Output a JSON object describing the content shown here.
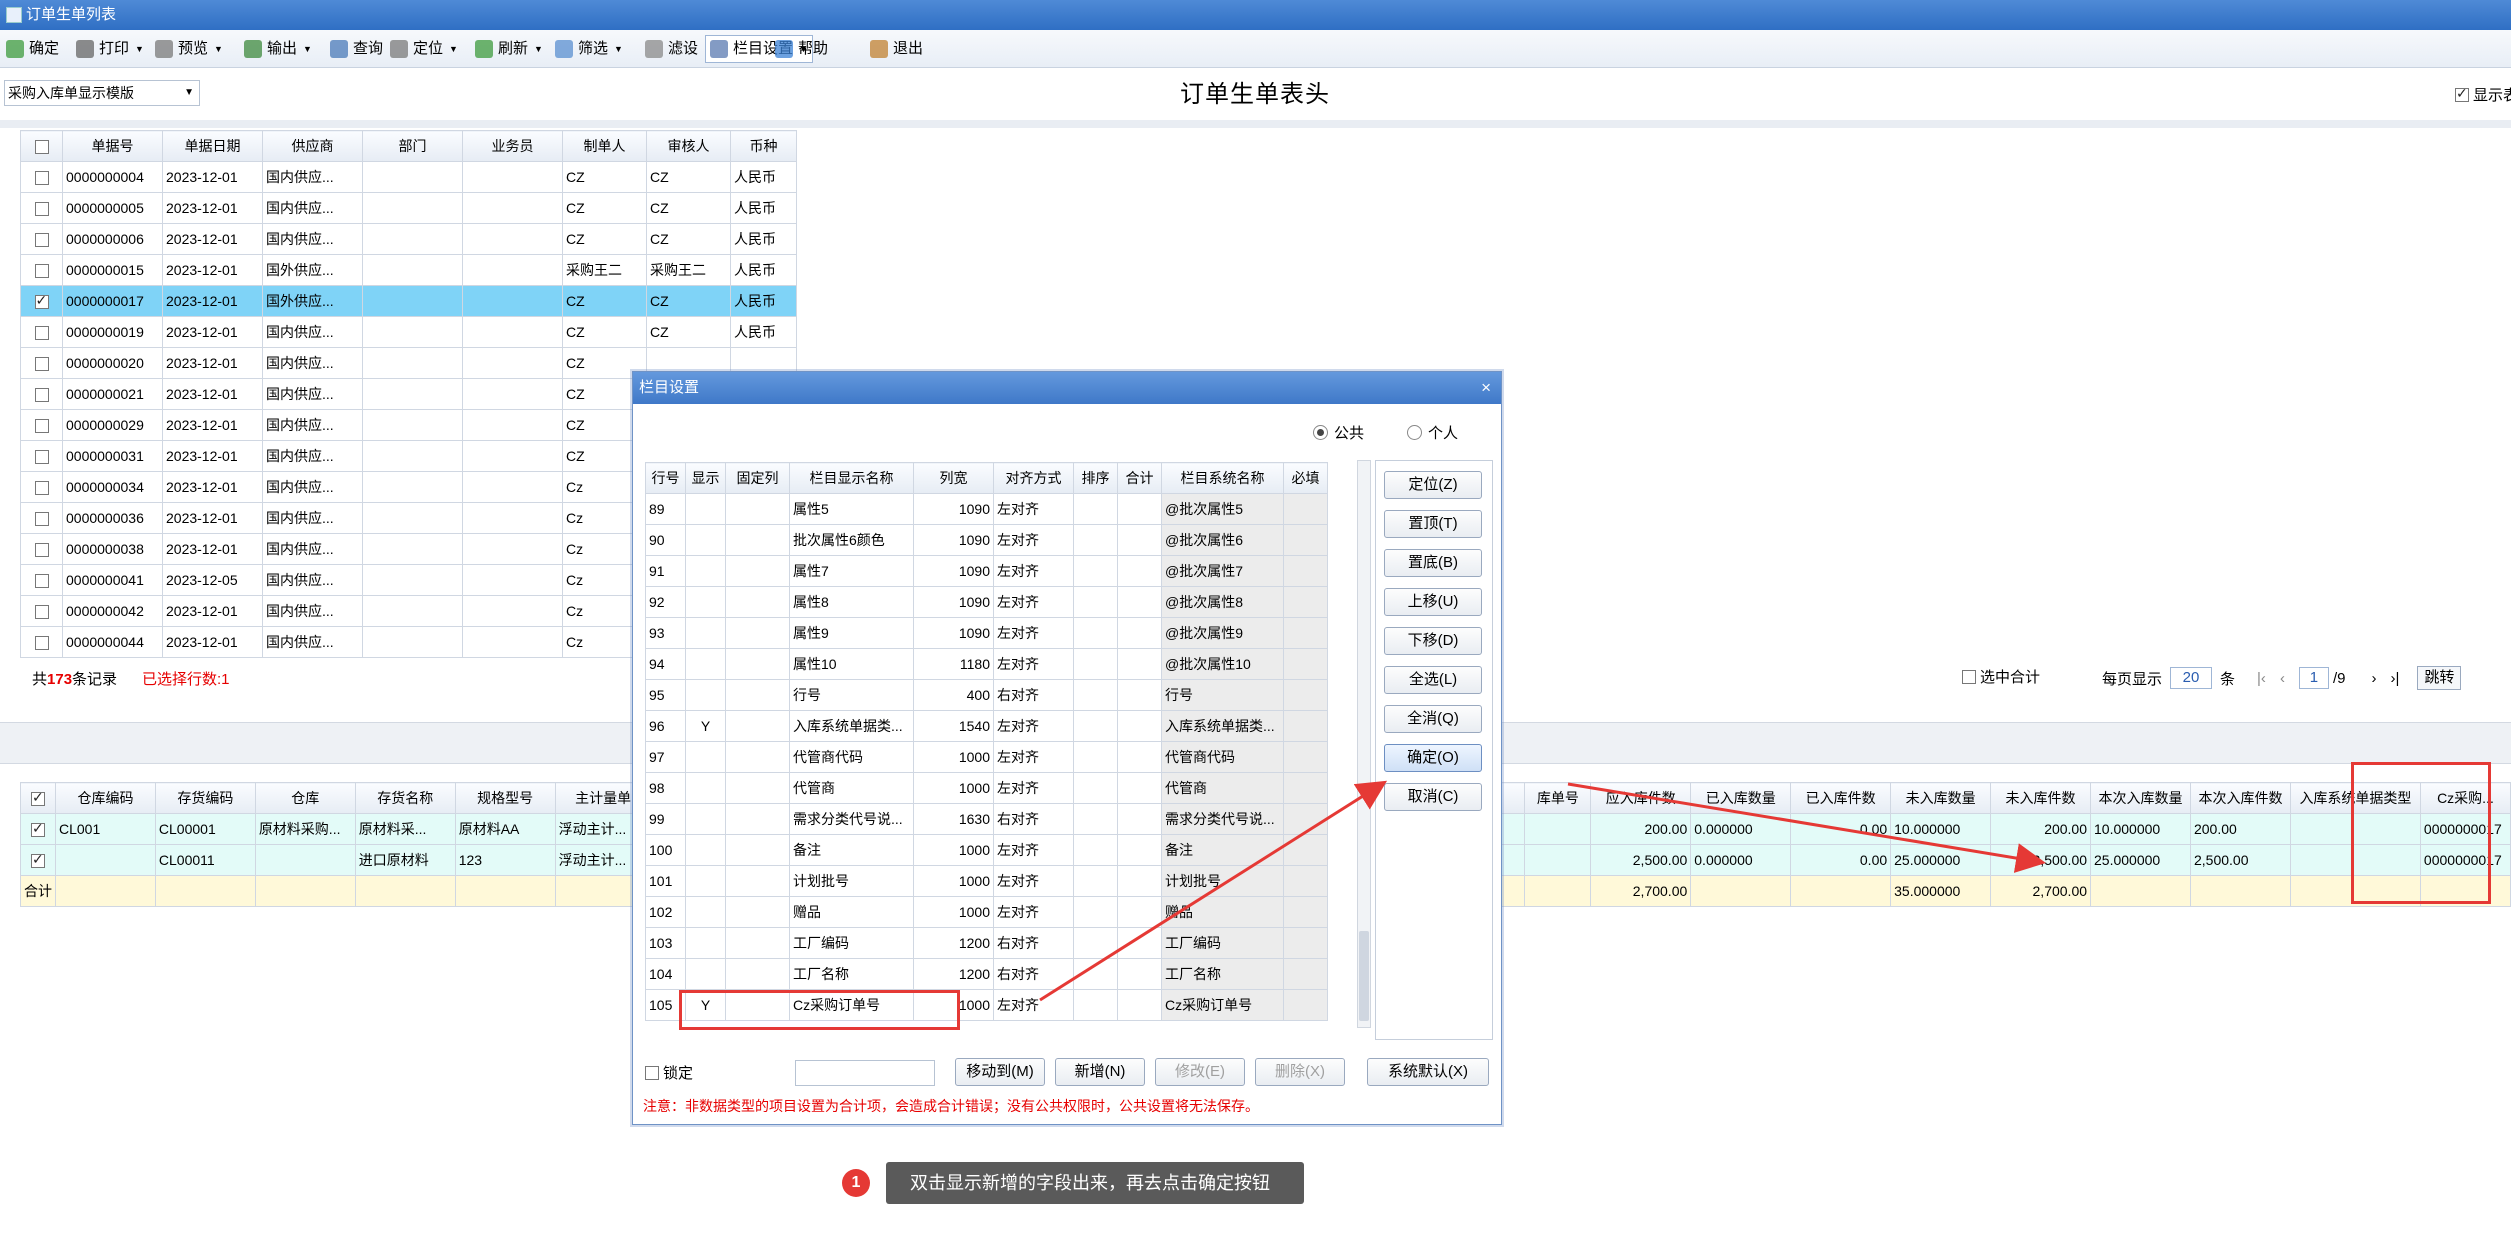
{
  "window": {
    "title": "订单生单列表"
  },
  "toolbar": [
    {
      "label": "确定",
      "icon": "check-icon"
    },
    {
      "label": "打印",
      "icon": "printer-icon",
      "dd": true
    },
    {
      "label": "预览",
      "icon": "preview-icon",
      "dd": true
    },
    {
      "label": "输出",
      "icon": "export-icon",
      "dd": true
    },
    {
      "label": "查询",
      "icon": "query-icon"
    },
    {
      "label": "定位",
      "icon": "locate-icon",
      "dd": true
    },
    {
      "label": "刷新",
      "icon": "refresh-icon",
      "dd": true
    },
    {
      "label": "筛选",
      "icon": "filter-icon",
      "dd": true
    },
    {
      "label": "滤设",
      "icon": "filter-settings-icon"
    },
    {
      "label": "栏目设置",
      "icon": "column-settings-icon",
      "dd": true
    },
    {
      "label": "帮助",
      "icon": "help-icon"
    },
    {
      "label": "退出",
      "icon": "exit-icon"
    }
  ],
  "header": {
    "template": "采购入库单显示模版",
    "title": "订单生单表头",
    "show_label": "显示表"
  },
  "top_table": {
    "columns": [
      "单据号",
      "单据日期",
      "供应商",
      "部门",
      "业务员",
      "制单人",
      "审核人",
      "币种"
    ],
    "rows": [
      {
        "checked": false,
        "cells": [
          "0000000004",
          "2023-12-01",
          "国内供应...",
          "",
          "",
          "CZ",
          "CZ",
          "人民币"
        ]
      },
      {
        "checked": false,
        "cells": [
          "0000000005",
          "2023-12-01",
          "国内供应...",
          "",
          "",
          "CZ",
          "CZ",
          "人民币"
        ]
      },
      {
        "checked": false,
        "cells": [
          "0000000006",
          "2023-12-01",
          "国内供应...",
          "",
          "",
          "CZ",
          "CZ",
          "人民币"
        ]
      },
      {
        "checked": false,
        "cells": [
          "0000000015",
          "2023-12-01",
          "国外供应...",
          "",
          "",
          "采购王二",
          "采购王二",
          "人民币"
        ]
      },
      {
        "checked": true,
        "cells": [
          "0000000017",
          "2023-12-01",
          "国外供应...",
          "",
          "",
          "CZ",
          "CZ",
          "人民币"
        ]
      },
      {
        "checked": false,
        "cells": [
          "0000000019",
          "2023-12-01",
          "国内供应...",
          "",
          "",
          "CZ",
          "CZ",
          "人民币"
        ]
      },
      {
        "checked": false,
        "cells": [
          "0000000020",
          "2023-12-01",
          "国内供应...",
          "",
          "",
          "CZ",
          "",
          ""
        ]
      },
      {
        "checked": false,
        "cells": [
          "0000000021",
          "2023-12-01",
          "国内供应...",
          "",
          "",
          "CZ",
          "",
          ""
        ]
      },
      {
        "checked": false,
        "cells": [
          "0000000029",
          "2023-12-01",
          "国内供应...",
          "",
          "",
          "CZ",
          "",
          ""
        ]
      },
      {
        "checked": false,
        "cells": [
          "0000000031",
          "2023-12-01",
          "国内供应...",
          "",
          "",
          "CZ",
          "",
          ""
        ]
      },
      {
        "checked": false,
        "cells": [
          "0000000034",
          "2023-12-01",
          "国内供应...",
          "",
          "",
          "Cz",
          "",
          ""
        ]
      },
      {
        "checked": false,
        "cells": [
          "0000000036",
          "2023-12-01",
          "国内供应...",
          "",
          "",
          "Cz",
          "",
          ""
        ]
      },
      {
        "checked": false,
        "cells": [
          "0000000038",
          "2023-12-01",
          "国内供应...",
          "",
          "",
          "Cz",
          "",
          ""
        ]
      },
      {
        "checked": false,
        "cells": [
          "0000000041",
          "2023-12-05",
          "国内供应...",
          "",
          "",
          "Cz",
          "",
          ""
        ]
      },
      {
        "checked": false,
        "cells": [
          "0000000042",
          "2023-12-01",
          "国内供应...",
          "",
          "",
          "Cz",
          "",
          ""
        ]
      },
      {
        "checked": false,
        "cells": [
          "0000000044",
          "2023-12-01",
          "国内供应...",
          "",
          "",
          "Cz",
          "",
          ""
        ]
      }
    ]
  },
  "status": {
    "total_prefix": "共",
    "total_count": "173",
    "total_suffix": "条记录",
    "selected": "已选择行数:1",
    "sum_check": "选中合计",
    "per_page_label": "每页显示",
    "per_page": "20",
    "per_page_unit": "条",
    "page": "1",
    "page_total": "/9",
    "jump": "跳转"
  },
  "bottom_table": {
    "columns_left": [
      "仓库编码",
      "存货编码",
      "仓库",
      "存货名称",
      "规格型号",
      "主计量单"
    ],
    "columns_right": [
      "库单号",
      "应入库件数",
      "已入库数量",
      "已入库件数",
      "未入库数量",
      "未入库件数",
      "本次入库数量",
      "本次入库件数",
      "入库系统单据类型",
      "Cz采购..."
    ],
    "rows": [
      {
        "checked": true,
        "left": [
          "CL001",
          "CL00001",
          "原材料采购...",
          "原材料采...",
          "原材料AA",
          "浮动主计..."
        ],
        "right": [
          "",
          "200.00",
          "0.000000",
          "0.00",
          "10.000000",
          "200.00",
          "10.000000",
          "200.00",
          "",
          "0000000017"
        ]
      },
      {
        "checked": true,
        "left": [
          "",
          "CL00011",
          "",
          "进口原材料",
          "123",
          "浮动主计..."
        ],
        "right": [
          "",
          "2,500.00",
          "0.000000",
          "0.00",
          "25.000000",
          "2,500.00",
          "25.000000",
          "2,500.00",
          "",
          "0000000017"
        ]
      }
    ],
    "sum": {
      "label": "合计",
      "right": [
        "",
        "2,700.00",
        "",
        "",
        "35.000000",
        "2,700.00",
        "",
        "",
        "",
        ""
      ]
    }
  },
  "dialog": {
    "title": "栏目设置",
    "close": "×",
    "radio_public": "公共",
    "radio_personal": "个人",
    "columns": [
      "行号",
      "显示",
      "固定列",
      "栏目显示名称",
      "列宽",
      "对齐方式",
      "排序",
      "合计",
      "栏目系统名称",
      "必填"
    ],
    "rows": [
      [
        "89",
        "",
        "",
        "属性5",
        "1090",
        "左对齐",
        "",
        "",
        "@批次属性5",
        ""
      ],
      [
        "90",
        "",
        "",
        "批次属性6颜色",
        "1090",
        "左对齐",
        "",
        "",
        "@批次属性6",
        ""
      ],
      [
        "91",
        "",
        "",
        "属性7",
        "1090",
        "左对齐",
        "",
        "",
        "@批次属性7",
        ""
      ],
      [
        "92",
        "",
        "",
        "属性8",
        "1090",
        "左对齐",
        "",
        "",
        "@批次属性8",
        ""
      ],
      [
        "93",
        "",
        "",
        "属性9",
        "1090",
        "左对齐",
        "",
        "",
        "@批次属性9",
        ""
      ],
      [
        "94",
        "",
        "",
        "属性10",
        "1180",
        "左对齐",
        "",
        "",
        "@批次属性10",
        ""
      ],
      [
        "95",
        "",
        "",
        "行号",
        "400",
        "右对齐",
        "",
        "",
        "行号",
        ""
      ],
      [
        "96",
        "Y",
        "",
        "入库系统单据类...",
        "1540",
        "左对齐",
        "",
        "",
        "入库系统单据类...",
        ""
      ],
      [
        "97",
        "",
        "",
        "代管商代码",
        "1000",
        "左对齐",
        "",
        "",
        "代管商代码",
        ""
      ],
      [
        "98",
        "",
        "",
        "代管商",
        "1000",
        "左对齐",
        "",
        "",
        "代管商",
        ""
      ],
      [
        "99",
        "",
        "",
        "需求分类代号说...",
        "1630",
        "右对齐",
        "",
        "",
        "需求分类代号说...",
        ""
      ],
      [
        "100",
        "",
        "",
        "备注",
        "1000",
        "左对齐",
        "",
        "",
        "备注",
        ""
      ],
      [
        "101",
        "",
        "",
        "计划批号",
        "1000",
        "左对齐",
        "",
        "",
        "计划批号",
        ""
      ],
      [
        "102",
        "",
        "",
        "赠品",
        "1000",
        "左对齐",
        "",
        "",
        "赠品",
        ""
      ],
      [
        "103",
        "",
        "",
        "工厂编码",
        "1200",
        "右对齐",
        "",
        "",
        "工厂编码",
        ""
      ],
      [
        "104",
        "",
        "",
        "工厂名称",
        "1200",
        "右对齐",
        "",
        "",
        "工厂名称",
        ""
      ],
      [
        "105",
        "Y",
        "",
        "Cz采购订单号",
        "1000",
        "左对齐",
        "",
        "",
        "Cz采购订单号",
        ""
      ]
    ],
    "side_buttons": [
      "定位(Z)",
      "置顶(T)",
      "置底(B)",
      "上移(U)",
      "下移(D)",
      "全选(L)",
      "全消(Q)",
      "确定(O)",
      "取消(C)"
    ],
    "lock_label": "锁定",
    "move_input": "",
    "footer_buttons": [
      "移动到(M)",
      "新增(N)",
      "修改(E)",
      "删除(X)",
      "系统默认(X)"
    ],
    "note": "注意：非数据类型的项目设置为合计项，会造成合计错误；没有公共权限时，公共设置将无法保存。"
  },
  "tip": {
    "badge": "1",
    "text": "双击显示新增的字段出来，再去点击确定按钮"
  },
  "colors": {
    "title_bar": "#3a7bd0",
    "selected_row": "#7fd3f7",
    "annotation_red": "#e53935",
    "sum_row": "#fff9d9",
    "data_row": "#e3fbf8"
  }
}
